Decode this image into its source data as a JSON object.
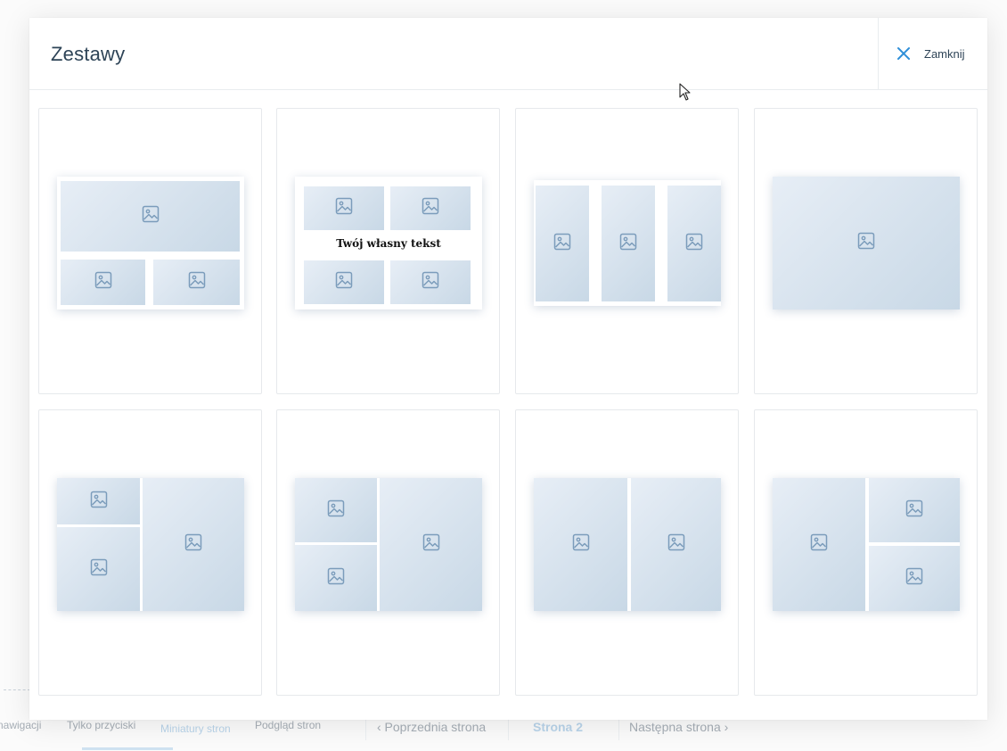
{
  "background": {
    "nav_label_fragment": "nawigacji",
    "tabs": [
      "Tylko przyciski",
      "Miniatury stron",
      "Podgląd stron"
    ],
    "prev_page": "‹ Poprzednia strona",
    "current_page": "Strona 2",
    "next_page": "Następna strona ›"
  },
  "modal": {
    "title": "Zestawy",
    "close_label": "Zamknij",
    "close_icon": "close-icon",
    "templates": [
      {
        "name": "one-large-top-two-bottom"
      },
      {
        "name": "four-photos-with-text",
        "text": "Twój własny tekst"
      },
      {
        "name": "three-vertical"
      },
      {
        "name": "single-photo"
      },
      {
        "name": "two-left-stack-one-right"
      },
      {
        "name": "two-left-stack-one-right-alt"
      },
      {
        "name": "two-vertical"
      },
      {
        "name": "one-left-two-right-stack"
      }
    ]
  },
  "colors": {
    "title": "#2e4457",
    "accent": "#2f8fd8",
    "placeholder_light": "#e7eef6",
    "placeholder_dark": "#c8d8e6",
    "placeholder_icon": "#7b9cbb"
  }
}
